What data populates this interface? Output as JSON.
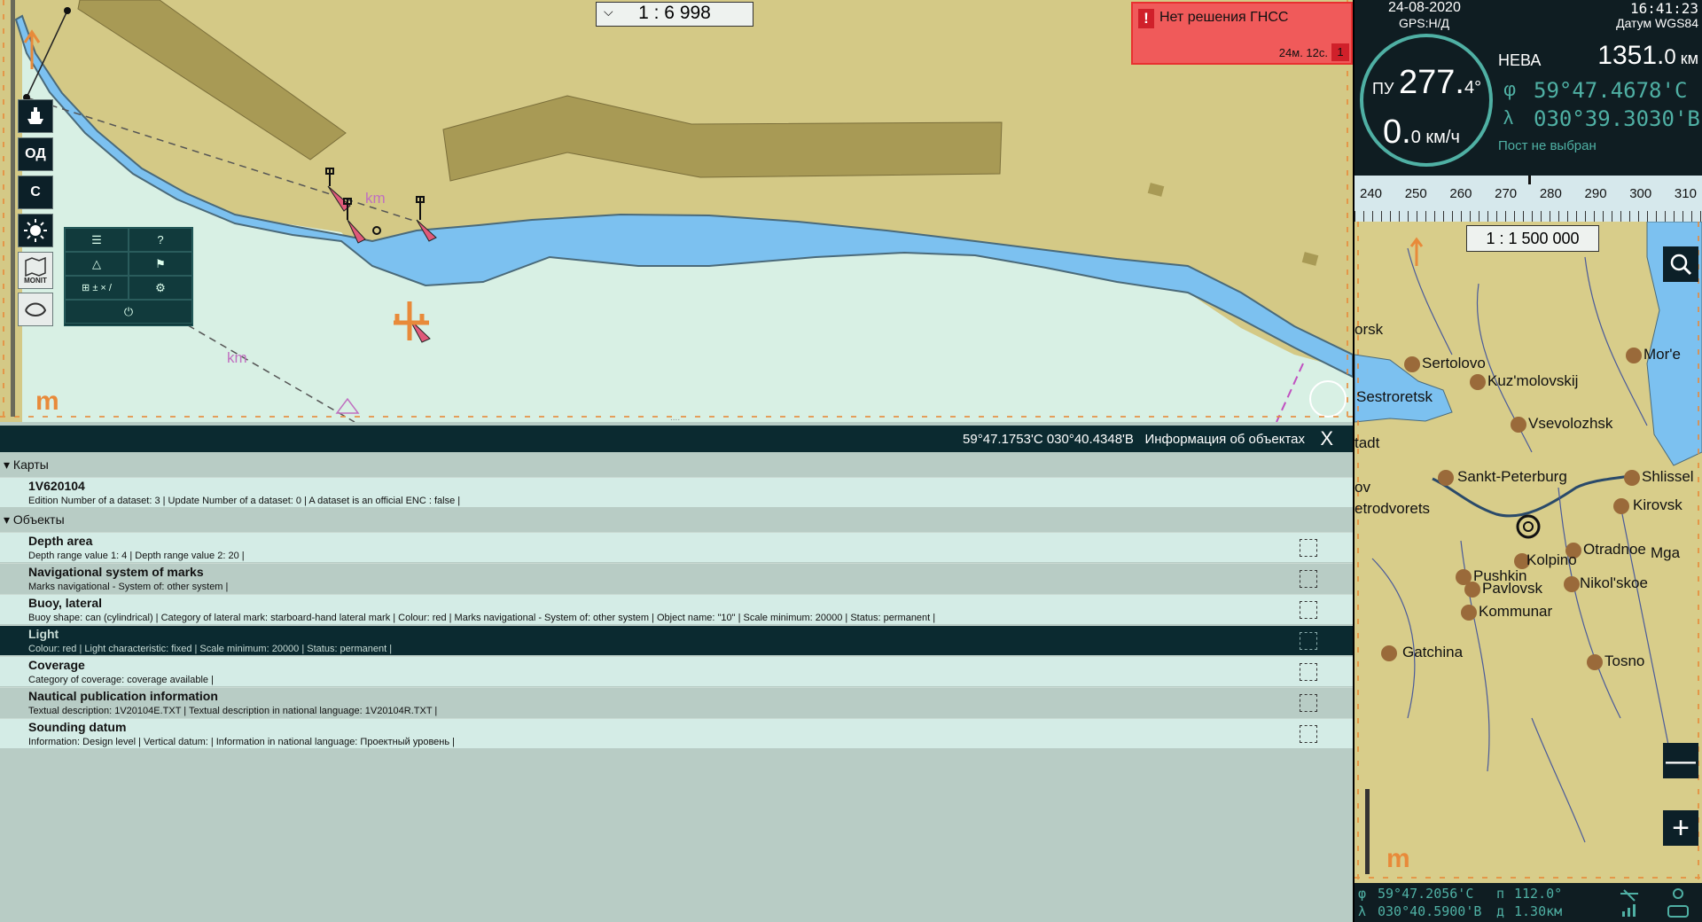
{
  "chart": {
    "scale_label": "1 : 6 998",
    "scale_arrow": "⌵",
    "map_labels": {
      "km1": "km",
      "km2": "km",
      "m_logo": "m"
    },
    "side_buttons": [
      {
        "name": "ship-icon",
        "label": ""
      },
      {
        "name": "od-button",
        "label": "ОД"
      },
      {
        "name": "c-button",
        "label": "С"
      },
      {
        "name": "brightness-icon",
        "label": ""
      },
      {
        "name": "monit-button",
        "label": "MONIT"
      },
      {
        "name": "route-icon",
        "label": ""
      }
    ],
    "menu_items": [
      "☰",
      "?",
      "△",
      "⚑",
      "⊞ ± × /",
      "⚙",
      "⏻"
    ]
  },
  "alert": {
    "icon": "!",
    "message": "Нет решения ГНСС",
    "time": "24м. 12с.",
    "count": "1"
  },
  "info_panel": {
    "coords": "59°47.1753'С 030°40.4348'В",
    "title": "Информация об объектах",
    "close": "X",
    "handle": "....",
    "sections": [
      {
        "label": "Карты"
      },
      {
        "label": "Объекты"
      }
    ],
    "maps": [
      {
        "name": "1V620104",
        "desc": "Edition Number of a dataset: 3 | Update Number of a dataset: 0 | A dataset is an official ENC :  false  |"
      }
    ],
    "objects": [
      {
        "name": "Depth area",
        "desc": "Depth range value 1: 4 | Depth range value 2: 20 |"
      },
      {
        "name": "Navigational system of marks",
        "desc": "Marks navigational - System of: other system |"
      },
      {
        "name": "Buoy, lateral",
        "desc": "Buoy shape: can (cylindrical) | Category of lateral mark: starboard-hand lateral mark | Colour: red | Marks navigational - System of: other system | Object name: \"10\" | Scale minimum: 20000 | Status: permanent |"
      },
      {
        "name": "Light",
        "desc": "Colour: red | Light characteristic: fixed | Scale minimum: 20000 | Status: permanent |",
        "selected": true
      },
      {
        "name": "Coverage",
        "desc": "Category of coverage: coverage available |"
      },
      {
        "name": "Nautical publication information",
        "desc": "Textual description: 1V20104E.TXT | Textual description in national language: 1V20104R.TXT |"
      },
      {
        "name": "Sounding datum",
        "desc": "Information: Design level | Vertical datum:  | Information in national language: Проектный уровень |"
      }
    ]
  },
  "nav": {
    "date": "24-08-2020",
    "time": "16:41:23",
    "gps": "GPS:Н/Д",
    "datum": "Датум WGS84",
    "vessel": "НЕВА",
    "distance_big": "1351.",
    "distance_small": "0",
    "distance_unit": " км",
    "heading_label": "ПУ",
    "heading_big": "277.",
    "heading_small": "4°",
    "speed_big": "0.",
    "speed_small": "0 км/ч",
    "lat_sym": "φ",
    "lat": "59°47.4678'С",
    "lon_sym": "λ",
    "lon": "030°39.3030'В",
    "post": "Пост не выбран",
    "compass_ticks": [
      "240",
      "250",
      "260",
      "270",
      "280",
      "290",
      "300",
      "310"
    ]
  },
  "minimap": {
    "scale": "1 : 1 500 000",
    "zoom_out": "—",
    "zoom_in": "+",
    "logo": "m",
    "cities": [
      {
        "name": "orsk"
      },
      {
        "name": "Sertolovo"
      },
      {
        "name": "Kuz'molovskij"
      },
      {
        "name": "Sestroretsk"
      },
      {
        "name": "Vsevolozhsk"
      },
      {
        "name": "Mor'e"
      },
      {
        "name": "tadt"
      },
      {
        "name": "ov"
      },
      {
        "name": "Sankt-Peterburg"
      },
      {
        "name": "Shlissel"
      },
      {
        "name": "etrodvorets"
      },
      {
        "name": "Kirovsk"
      },
      {
        "name": "Otradnoe"
      },
      {
        "name": "Mga"
      },
      {
        "name": "Kolpino"
      },
      {
        "name": "Pushkin"
      },
      {
        "name": "Pavlovsk"
      },
      {
        "name": "Nikol'skoe"
      },
      {
        "name": "Kommunar"
      },
      {
        "name": "Gatchina"
      },
      {
        "name": "Tosno"
      }
    ]
  },
  "status": {
    "lat_sym": "φ",
    "lat": "59°47.2056'С",
    "lon_sym": "λ",
    "lon": "030°40.5900'В",
    "bearing_sym": "п",
    "bearing": "112.0°",
    "dist_sym": "д",
    "dist": "1.30км"
  },
  "colors": {
    "land": "#d8cd8a",
    "water": "#7cc1f0",
    "shallow": "#d8f0e4",
    "panel_dark": "#0b2a30",
    "alert_red": "#f05a5a",
    "accent_teal": "#4fb0a4"
  }
}
